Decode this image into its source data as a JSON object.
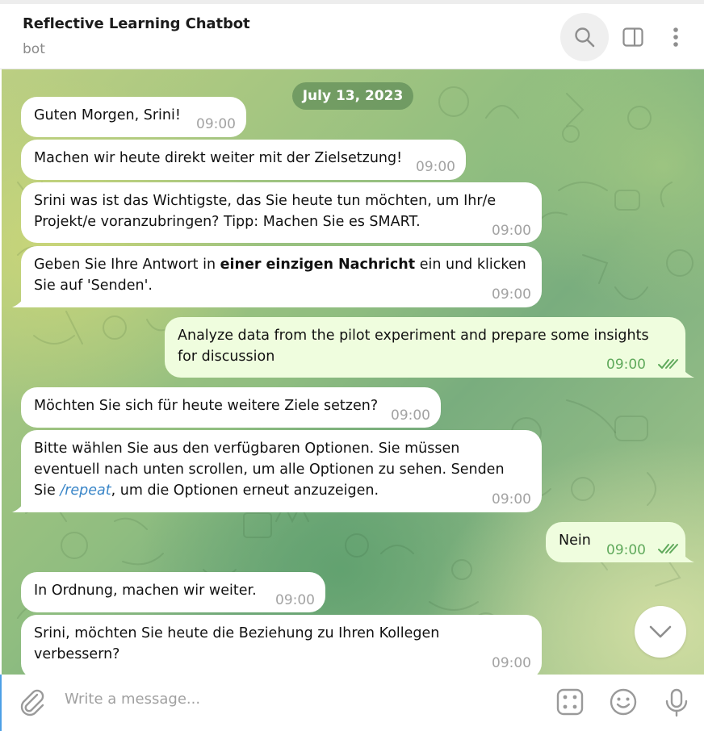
{
  "header": {
    "title": "Reflective Learning Chatbot",
    "subtitle": "bot",
    "search_icon": "search-icon",
    "panel_icon": "sidebar-toggle-icon",
    "more_icon": "more-vertical-icon"
  },
  "chat": {
    "date": "July 13, 2023",
    "messages": [
      {
        "from": "bot",
        "lines": [
          "Guten Morgen, Srini!"
        ],
        "time": "09:00"
      },
      {
        "from": "bot",
        "lines": [
          "Machen wir heute direkt weiter mit der Zielsetzung!"
        ],
        "time": "09:00"
      },
      {
        "from": "bot",
        "lines": [
          "Srini was ist das Wichtigste, das Sie heute tun möchten, um Ihr/e",
          "Projekt/e voranzubringen? Tipp: Machen Sie es SMART."
        ],
        "time": "09:00"
      },
      {
        "from": "bot",
        "lines": [
          "Geben Sie Ihre Antwort in ",
          "einer einzigen Nachricht",
          " ein und klicken",
          "Sie auf 'Senden'."
        ],
        "time": "09:00"
      },
      {
        "from": "user",
        "lines": [
          "Analyze data from the pilot experiment and prepare some insights",
          "for discussion"
        ],
        "time": "09:00",
        "status": "read"
      },
      {
        "from": "bot",
        "lines": [
          "Möchten Sie sich für heute weitere Ziele setzen?"
        ],
        "time": "09:00"
      },
      {
        "from": "bot",
        "lines": [
          "Bitte wählen Sie aus den verfügbaren Optionen. Sie müssen",
          "eventuell nach unten scrollen, um alle Optionen zu sehen. Senden",
          "Sie ",
          "/repeat",
          ", um die Optionen erneut anzuzeigen."
        ],
        "time": "09:00"
      },
      {
        "from": "user",
        "lines": [
          "Nein"
        ],
        "time": "09:00",
        "status": "read"
      },
      {
        "from": "bot",
        "lines": [
          "In Ordnung, machen wir weiter."
        ],
        "time": "09:00"
      },
      {
        "from": "bot",
        "lines": [
          "Srini, möchten Sie heute die Beziehung zu Ihren Kollegen",
          "verbessern?"
        ],
        "time": "09:00"
      }
    ]
  },
  "composer": {
    "placeholder": "Write a message...",
    "attach_icon": "paperclip-icon",
    "commands_icon": "bot-commands-icon",
    "emoji_icon": "emoji-icon",
    "mic_icon": "microphone-icon"
  },
  "colors": {
    "incoming_bubble": "#ffffff",
    "outgoing_bubble": "#effdde",
    "outgoing_time": "#5fa95b",
    "link": "#3a86c8",
    "accent": "#4da0e6"
  }
}
